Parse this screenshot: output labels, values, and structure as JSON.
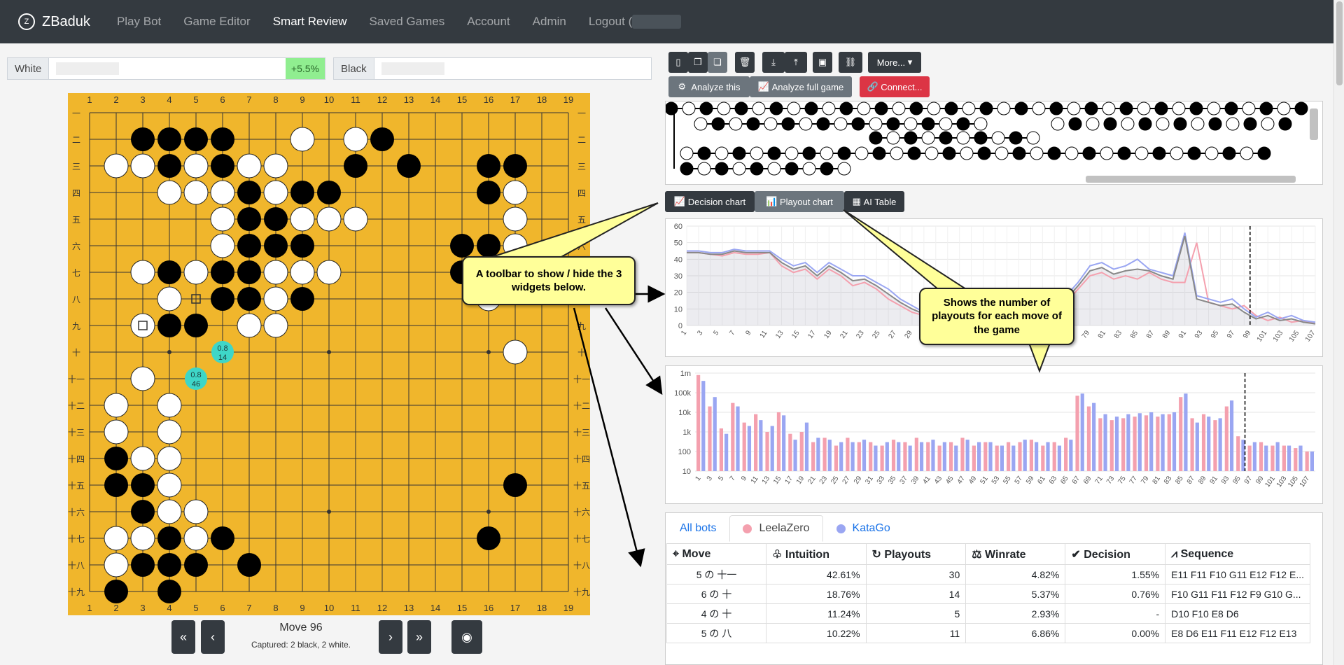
{
  "nav": {
    "brand": "ZBaduk",
    "links": [
      "Play Bot",
      "Game Editor",
      "Smart Review",
      "Saved Games",
      "Account",
      "Admin",
      "Logout ("
    ],
    "active_index": 2
  },
  "players": {
    "white_label": "White",
    "white_score": "+5.5%",
    "black_label": "Black"
  },
  "board": {
    "size": 19,
    "col_labels": [
      "1",
      "2",
      "3",
      "4",
      "5",
      "6",
      "7",
      "8",
      "9",
      "10",
      "11",
      "12",
      "13",
      "14",
      "15",
      "16",
      "17",
      "18",
      "19"
    ],
    "row_labels": [
      "一",
      "二",
      "三",
      "四",
      "五",
      "六",
      "七",
      "八",
      "九",
      "十",
      "十一",
      "十二",
      "十三",
      "十四",
      "十五",
      "十六",
      "十七",
      "十八",
      "十九"
    ],
    "stones": {
      "black": [
        [
          3,
          2
        ],
        [
          4,
          2
        ],
        [
          5,
          2
        ],
        [
          6,
          2
        ],
        [
          12,
          2
        ],
        [
          4,
          3
        ],
        [
          6,
          3
        ],
        [
          11,
          3
        ],
        [
          13,
          3
        ],
        [
          16,
          3
        ],
        [
          17,
          3
        ],
        [
          7,
          4
        ],
        [
          9,
          4
        ],
        [
          10,
          4
        ],
        [
          16,
          4
        ],
        [
          7,
          5
        ],
        [
          8,
          5
        ],
        [
          15,
          6
        ],
        [
          16,
          6
        ],
        [
          7,
          6
        ],
        [
          8,
          6
        ],
        [
          9,
          6
        ],
        [
          4,
          7
        ],
        [
          6,
          7
        ],
        [
          7,
          7
        ],
        [
          8,
          7
        ],
        [
          15,
          7
        ],
        [
          6,
          8
        ],
        [
          7,
          8
        ],
        [
          9,
          8
        ],
        [
          4,
          9
        ],
        [
          5,
          9
        ],
        [
          2,
          14
        ],
        [
          2,
          15
        ],
        [
          3,
          15
        ],
        [
          3,
          16
        ],
        [
          17,
          15
        ],
        [
          4,
          17
        ],
        [
          6,
          17
        ],
        [
          16,
          17
        ],
        [
          3,
          18
        ],
        [
          4,
          18
        ],
        [
          5,
          18
        ],
        [
          7,
          18
        ],
        [
          2,
          19
        ],
        [
          4,
          19
        ]
      ],
      "white": [
        [
          9,
          2
        ],
        [
          11,
          2
        ],
        [
          2,
          3
        ],
        [
          3,
          3
        ],
        [
          5,
          3
        ],
        [
          7,
          3
        ],
        [
          8,
          3
        ],
        [
          4,
          4
        ],
        [
          5,
          4
        ],
        [
          6,
          4
        ],
        [
          8,
          4
        ],
        [
          17,
          4
        ],
        [
          6,
          5
        ],
        [
          9,
          5
        ],
        [
          10,
          5
        ],
        [
          11,
          5
        ],
        [
          17,
          5
        ],
        [
          6,
          6
        ],
        [
          17,
          6
        ],
        [
          3,
          7
        ],
        [
          5,
          7
        ],
        [
          8,
          7
        ],
        [
          9,
          7
        ],
        [
          10,
          7
        ],
        [
          4,
          8
        ],
        [
          8,
          8
        ],
        [
          16,
          8
        ],
        [
          3,
          9
        ],
        [
          7,
          9
        ],
        [
          8,
          9
        ],
        [
          17,
          10
        ],
        [
          3,
          11
        ],
        [
          2,
          12
        ],
        [
          4,
          12
        ],
        [
          2,
          13
        ],
        [
          4,
          13
        ],
        [
          3,
          14
        ],
        [
          4,
          14
        ],
        [
          4,
          15
        ],
        [
          4,
          16
        ],
        [
          5,
          16
        ],
        [
          2,
          17
        ],
        [
          3,
          17
        ],
        [
          5,
          17
        ],
        [
          2,
          18
        ]
      ]
    },
    "markers": [
      {
        "col": 5,
        "row": 8,
        "type": "square"
      },
      {
        "col": 3,
        "row": 9,
        "type": "square"
      }
    ],
    "hints": [
      {
        "col": 6,
        "row": 10,
        "line1": "0.8",
        "line2": "14"
      },
      {
        "col": 5,
        "row": 11,
        "line1": "0.8",
        "line2": "46"
      }
    ]
  },
  "controls": {
    "move_label": "Move 96",
    "captured": "Captured: 2 black, 2 white."
  },
  "toolbar": {
    "more_label": "More...",
    "analyze_this": "Analyze this",
    "analyze_full": "Analyze full game",
    "connect": "Connect..."
  },
  "widget_toggles": {
    "decision": "Decision chart",
    "playout": "Playout chart",
    "ai_table": "AI Table"
  },
  "callouts": {
    "toolbar_note": "A toolbar to show / hide the 3 widgets below.",
    "playout_note": "Shows the number of playouts for each move of the game"
  },
  "colors": {
    "leela": "#f4a0ae",
    "katago": "#9aa6f2",
    "combined": "#888888",
    "board": "#f0b62c"
  },
  "chart_data": [
    {
      "type": "line",
      "ylim": [
        0,
        60
      ],
      "yticks": [
        0,
        10,
        20,
        30,
        40,
        50,
        60
      ],
      "x": [
        1,
        3,
        5,
        7,
        9,
        11,
        13,
        15,
        17,
        19,
        21,
        23,
        25,
        27,
        29,
        31,
        33,
        35,
        37,
        39,
        41,
        43,
        45,
        47,
        49,
        51,
        53,
        55,
        57,
        59,
        61,
        63,
        65,
        67,
        69,
        71,
        73,
        75,
        77,
        79,
        81,
        83,
        85,
        87,
        89,
        91,
        93,
        95,
        97,
        99,
        101,
        103,
        105,
        107
      ],
      "x_tick_labels": [
        "1",
        "3",
        "5",
        "7",
        "9",
        "11",
        "13",
        "15",
        "17",
        "19",
        "21",
        "23",
        "25",
        "27",
        "29",
        "31",
        "33",
        "35",
        "37",
        "39",
        "69",
        "71",
        "73",
        "75",
        "77",
        "79",
        "81",
        "83",
        "85",
        "87",
        "89",
        "91",
        "93",
        "95",
        "97",
        "99",
        "101",
        "103",
        "105",
        "107"
      ],
      "current_move": 96,
      "series": [
        {
          "values": [
            44,
            44,
            43,
            42,
            44,
            43,
            43,
            44,
            36,
            32,
            34,
            28,
            34,
            30,
            24,
            26,
            22,
            16,
            12,
            8,
            6,
            5,
            4,
            3,
            3,
            2,
            2,
            2,
            3,
            4,
            5,
            8,
            14,
            22,
            30,
            32,
            28,
            30,
            28,
            32,
            28,
            26,
            26,
            50,
            14,
            12,
            10,
            12,
            6,
            3,
            5,
            2,
            3,
            1
          ]
        },
        {
          "values": [
            45,
            45,
            44,
            44,
            46,
            45,
            45,
            45,
            40,
            36,
            38,
            32,
            38,
            34,
            30,
            30,
            26,
            22,
            16,
            12,
            8,
            7,
            5,
            4,
            4,
            3,
            3,
            3,
            4,
            5,
            6,
            10,
            18,
            26,
            36,
            38,
            34,
            36,
            40,
            34,
            32,
            30,
            56,
            18,
            16,
            14,
            16,
            10,
            5,
            8,
            4,
            6,
            3,
            2
          ]
        },
        {
          "values": [
            44,
            44,
            43,
            43,
            45,
            44,
            44,
            44,
            38,
            34,
            36,
            30,
            36,
            32,
            27,
            28,
            24,
            19,
            14,
            10,
            7,
            6,
            5,
            4,
            3,
            3,
            2,
            2,
            3,
            4,
            5,
            9,
            16,
            24,
            33,
            35,
            31,
            33,
            34,
            33,
            30,
            28,
            54,
            16,
            14,
            12,
            13,
            8,
            4,
            6,
            3,
            4,
            2,
            1
          ]
        }
      ]
    },
    {
      "type": "bar",
      "scale": "log",
      "ytick_labels": [
        "10",
        "100",
        "1k",
        "10k",
        "100k",
        "1m"
      ],
      "x": [
        1,
        3,
        5,
        7,
        9,
        11,
        13,
        15,
        17,
        19,
        21,
        23,
        25,
        27,
        29,
        31,
        33,
        35,
        37,
        39,
        41,
        43,
        45,
        47,
        49,
        51,
        53,
        55,
        57,
        59,
        61,
        63,
        65,
        67,
        69,
        71,
        73,
        75,
        77,
        79,
        81,
        83,
        85,
        87,
        89,
        91,
        93,
        95,
        97,
        99,
        101,
        103,
        105,
        107
      ],
      "x_tick_labels": [
        "1",
        "3",
        "5",
        "7",
        "9",
        "11",
        "13",
        "15",
        "17",
        "19",
        "21",
        "23",
        "25",
        "27",
        "29",
        "31",
        "33",
        "35",
        "37",
        "39",
        "41",
        "43",
        "45",
        "47",
        "49",
        "51",
        "53",
        "55",
        "57",
        "59",
        "61",
        "63",
        "65",
        "67",
        "69",
        "71",
        "73",
        "75",
        "77",
        "79",
        "81",
        "83",
        "85",
        "87",
        "89",
        "91",
        "93",
        "95",
        "97",
        "99",
        "101",
        "103",
        "105",
        "107"
      ],
      "current_move": 96,
      "series": [
        {
          "values": [
            800000,
            20000,
            1500,
            30000,
            3000,
            8000,
            1000,
            10000,
            800,
            1000,
            300,
            500,
            200,
            500,
            300,
            300,
            200,
            400,
            300,
            500,
            300,
            200,
            300,
            500,
            200,
            300,
            200,
            300,
            300,
            400,
            200,
            300,
            500,
            70000,
            20000,
            5000,
            4000,
            5000,
            6000,
            7000,
            6000,
            8000,
            60000,
            5000,
            8000,
            4000,
            20000,
            600,
            200,
            300,
            200,
            200,
            150,
            100
          ]
        },
        {
          "values": [
            400000,
            60000,
            800,
            20000,
            2000,
            4000,
            2000,
            7000,
            400,
            3000,
            500,
            400,
            300,
            300,
            400,
            200,
            300,
            300,
            200,
            300,
            400,
            300,
            200,
            400,
            300,
            300,
            200,
            200,
            400,
            300,
            300,
            200,
            400,
            90000,
            30000,
            8000,
            6000,
            8000,
            9000,
            10000,
            8000,
            10000,
            90000,
            3000,
            6000,
            5000,
            40000,
            400,
            300,
            200,
            300,
            200,
            200,
            100
          ]
        }
      ]
    }
  ],
  "ai_table": {
    "tabs": [
      "All bots",
      "LeelaZero",
      "KataGo"
    ],
    "columns": [
      "Move",
      "Intuition",
      "Playouts",
      "Winrate",
      "Decision",
      "Sequence"
    ],
    "rows": [
      [
        "5 の 十一",
        "42.61%",
        "30",
        "4.82%",
        "1.55%",
        "E11 F11 F10 G11 E12 F12 E..."
      ],
      [
        "6 の 十",
        "18.76%",
        "14",
        "5.37%",
        "0.76%",
        "F10 G11 F11 F12 F9 G10 G..."
      ],
      [
        "4 の 十",
        "11.24%",
        "5",
        "2.93%",
        "-",
        "D10 F10 E8 D6"
      ],
      [
        "5 の 八",
        "10.22%",
        "11",
        "6.86%",
        "0.00%",
        "E8 D6 E11 F11 E12 F12 E13"
      ]
    ]
  }
}
